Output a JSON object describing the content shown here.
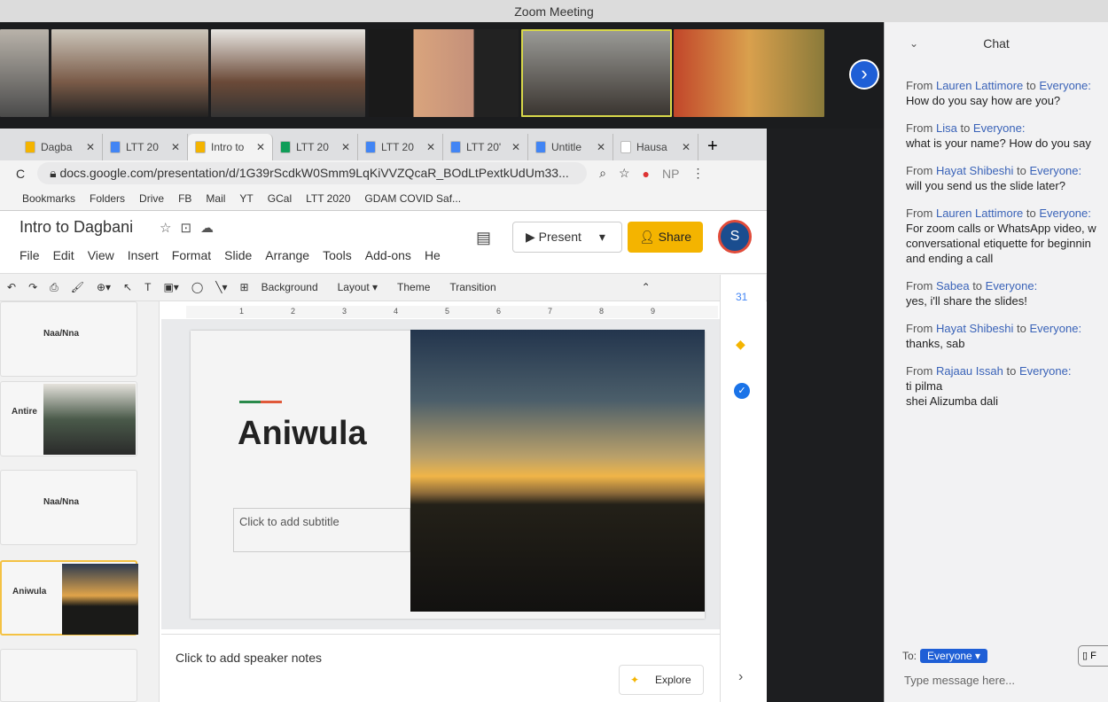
{
  "window": {
    "title": "Zoom Meeting"
  },
  "chat": {
    "title": "Chat",
    "messages": [
      {
        "from": "Lauren Lattimore",
        "to": "Everyone",
        "lines": [
          "How do you say how are you?"
        ]
      },
      {
        "from": "Lisa",
        "to": "Everyone",
        "lines": [
          "what is your name? How do you say"
        ]
      },
      {
        "from": "Hayat Shibeshi",
        "to": "Everyone",
        "lines": [
          "will you send us the slide later?"
        ]
      },
      {
        "from": "Lauren Lattimore",
        "to": "Everyone",
        "lines": [
          "For zoom calls or WhatsApp video, w",
          "conversational etiquette for beginnin",
          "and ending a call"
        ]
      },
      {
        "from": "Sabea",
        "to": "Everyone",
        "lines": [
          "yes, i'll share the slides!"
        ]
      },
      {
        "from": "Hayat Shibeshi",
        "to": "Everyone",
        "lines": [
          "thanks, sab"
        ]
      },
      {
        "from": "Rajaau Issah",
        "to": "Everyone",
        "lines": [
          "ti pilma",
          "shei Alizumba dali"
        ]
      }
    ],
    "from_word": "From",
    "to_word": "to",
    "to_label": "To:",
    "recipient": "Everyone ▾",
    "placeholder": "Type message here...",
    "file_label": "F"
  },
  "browser": {
    "tabs": [
      {
        "label": "Dagba",
        "icon": "drive-icon",
        "color": "#f4b400"
      },
      {
        "label": "LTT 20",
        "icon": "docs-icon",
        "color": "#4285f4"
      },
      {
        "label": "Intro to",
        "icon": "slides-icon",
        "color": "#f4b400",
        "active": true
      },
      {
        "label": "LTT 20",
        "icon": "drive-icon",
        "color": "#0f9d58"
      },
      {
        "label": "LTT 20",
        "icon": "docs-icon",
        "color": "#4285f4"
      },
      {
        "label": "LTT 20'",
        "icon": "docs-icon",
        "color": "#4285f4"
      },
      {
        "label": "Untitle",
        "icon": "docs-icon",
        "color": "#4285f4"
      },
      {
        "label": "Hausa",
        "icon": "wikipedia-icon",
        "color": "#ffffff"
      }
    ],
    "url": "docs.google.com/presentation/d/1G39rScdkW0Smm9LqKiVVZQcaR_BOdLtPextkUdUm33...",
    "bookmarks": [
      "Bookmarks",
      "Folders",
      "Drive",
      "FB",
      "Mail",
      "YT",
      "GCal",
      "LTT 2020",
      "GDAM COVID Saf..."
    ],
    "ext_np": "NP"
  },
  "slides": {
    "doc_title": "Intro to Dagbani",
    "menu": [
      "File",
      "Edit",
      "View",
      "Insert",
      "Format",
      "Slide",
      "Arrange",
      "Tools",
      "Add-ons",
      "He"
    ],
    "present": "Present",
    "share": "Share",
    "avatar": "S",
    "toolbar": [
      "Background",
      "Layout ▾",
      "Theme",
      "Transition"
    ],
    "ruler": [
      "1",
      "2",
      "3",
      "4",
      "5",
      "6",
      "7",
      "8",
      "9"
    ],
    "thumbs": [
      "Naa/Nna",
      "Antire",
      "Naa/Nna",
      "Aniwula"
    ],
    "slide_title": "Aniwula",
    "subtitle_placeholder": "Click to add subtitle",
    "notes_placeholder": "Click to add speaker notes",
    "explore": "Explore"
  }
}
